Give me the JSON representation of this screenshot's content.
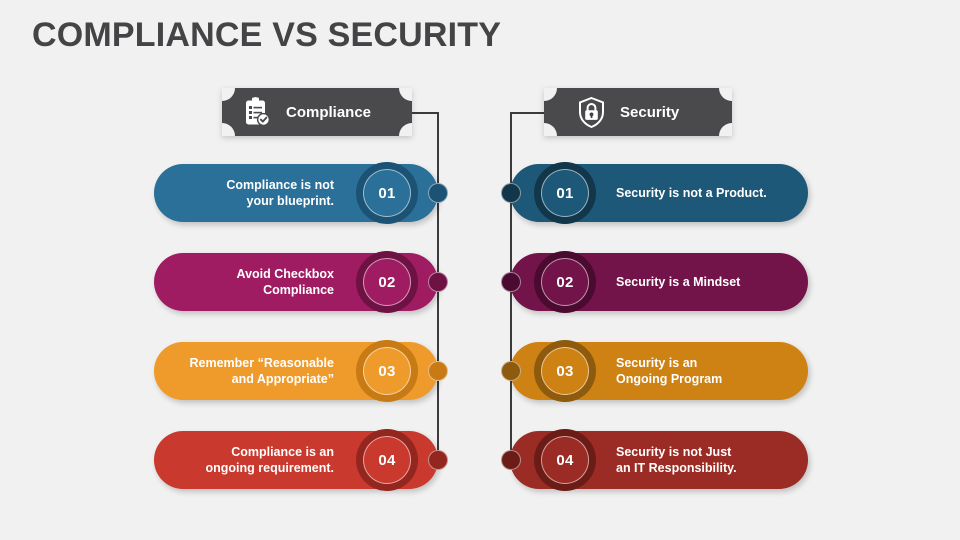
{
  "slide": {
    "title": "COMPLIANCE VS SECURITY",
    "background_color": "#f1f1f1",
    "title_color": "#444446",
    "connector_color": "#3b3b3d"
  },
  "columns": [
    {
      "key": "compliance",
      "side": "left",
      "header": {
        "label": "Compliance",
        "icon": "clipboard-check-icon",
        "background_color": "#4a4a4c",
        "text_color": "#ffffff"
      },
      "items": [
        {
          "number": "01",
          "lines": [
            "Compliance is not",
            "your blueprint."
          ],
          "pill_color": "#2a7099",
          "ring_color": "#1c5274",
          "dot_color": "#1c5274"
        },
        {
          "number": "02",
          "lines": [
            "Avoid Checkbox",
            "Compliance"
          ],
          "pill_color": "#a01c62",
          "ring_color": "#6e1244",
          "dot_color": "#6e1244"
        },
        {
          "number": "03",
          "lines": [
            "Remember “Reasonable",
            "and Appropriate”"
          ],
          "pill_color": "#ef9b2c",
          "ring_color": "#c87b14",
          "dot_color": "#c87b14"
        },
        {
          "number": "04",
          "lines": [
            "Compliance is an",
            "ongoing requirement."
          ],
          "pill_color": "#c9392e",
          "ring_color": "#93261f",
          "dot_color": "#93261f"
        }
      ]
    },
    {
      "key": "security",
      "side": "right",
      "header": {
        "label": "Security",
        "icon": "shield-lock-icon",
        "background_color": "#3f3f41",
        "text_color": "#ffffff"
      },
      "items": [
        {
          "number": "01",
          "lines": [
            "Security is not a Product."
          ],
          "pill_color": "#1e5878",
          "ring_color": "#12364a",
          "dot_color": "#12364a"
        },
        {
          "number": "02",
          "lines": [
            "Security is a Mindset"
          ],
          "pill_color": "#72134a",
          "ring_color": "#4b0b30",
          "dot_color": "#4b0b30"
        },
        {
          "number": "03",
          "lines": [
            "Security is an",
            "Ongoing Program"
          ],
          "pill_color": "#cf8214",
          "ring_color": "#8d5a0e",
          "dot_color": "#8d5a0e"
        },
        {
          "number": "04",
          "lines": [
            "Security is not Just",
            "an IT Responsibility."
          ],
          "pill_color": "#9b2c25",
          "ring_color": "#6c1c17",
          "dot_color": "#6c1c17"
        }
      ]
    }
  ]
}
